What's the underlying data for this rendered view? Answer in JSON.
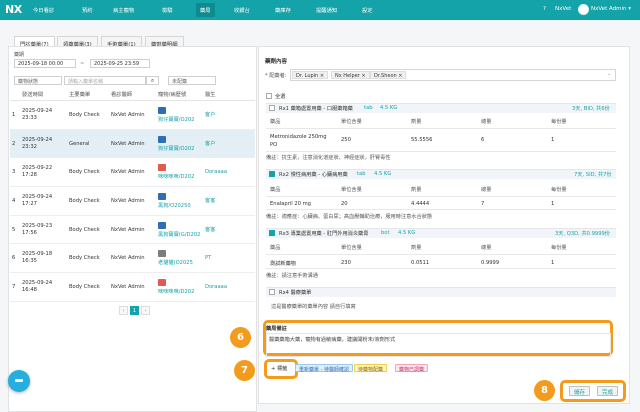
{
  "topbar": {
    "logo": "NX",
    "nav": [
      "今日看診",
      "預約",
      "病主寵物",
      "檢驗",
      "藥局",
      "收銀台",
      "藥庫存",
      "提醒通知",
      "設定"
    ],
    "help": "?",
    "brand": "NxVet",
    "user": "NxVet Admin ▾"
  },
  "tabs": [
    "門診藥單(7)",
    "領藥藥單(3)",
    "手術藥單(1)",
    "藥劑藥明細"
  ],
  "filters": {
    "date_label": "藥期",
    "date_from": "2025-09-18 00:00",
    "date_sep": "~",
    "date_to": "2025-09-25 23:59",
    "status_placeholder": "藥物狀態",
    "search_placeholder": "請輸入藥單名稱",
    "type_placeholder": "未配藥"
  },
  "orders_table": {
    "headers": [
      "",
      "發送時間",
      "主要藥單",
      "看診醫師",
      "寵物/病歷號",
      "醫生"
    ],
    "rows": [
      {
        "n": "1",
        "time": "2025-09-24 23:33",
        "type": "Body Check",
        "doctor": "NxVet Admin",
        "pet": "狗仔寶寶/O202",
        "vet": "客户",
        "icon": "blue"
      },
      {
        "n": "2",
        "time": "2025-09-24 23:32",
        "type": "General",
        "doctor": "NxVet Admin",
        "pet": "狗仔寶寶/O202",
        "vet": "客户",
        "icon": "blue"
      },
      {
        "n": "3",
        "time": "2025-09-22 17:28",
        "type": "Body Check",
        "doctor": "NxVet Admin",
        "pet": "咪咪咪咪/D202",
        "vet": "Doraaaa",
        "icon": "red"
      },
      {
        "n": "4",
        "time": "2025-09-24 17:27",
        "type": "Body Check",
        "doctor": "NxVet Admin",
        "pet": "黑狗/O20250",
        "vet": "客客",
        "icon": "blue"
      },
      {
        "n": "5",
        "time": "2025-09-23 17:56",
        "type": "Body Check",
        "doctor": "NxVet Admin",
        "pet": "黑狗寶寶(G/D202",
        "vet": "客客",
        "icon": "blue"
      },
      {
        "n": "6",
        "time": "2025-09-18 16:35",
        "type": "Body Check",
        "doctor": "NxVet Admin",
        "pet": "老貓貓(O2025",
        "vet": "PT",
        "icon": "gray"
      },
      {
        "n": "7",
        "time": "2025-09-24 16:48",
        "type": "Body Check",
        "doctor": "NxVet Admin",
        "pet": "咪咪咪咪/D202",
        "vet": "Doraaaa",
        "icon": "red"
      }
    ]
  },
  "pager": {
    "prev": "‹",
    "page": "1",
    "next": "›"
  },
  "right": {
    "section_title": "藥劑內容",
    "dispenser_label": "* 配藥者:",
    "dispensers": [
      "Dr. Lupin ×",
      "Nx Helper ×",
      "Dr.Sheon ×"
    ],
    "select_all": "全選",
    "rx": [
      {
        "title": "Rx1 藥箱處置用藥 - 口服藥箱藥",
        "tag": "tab",
        "amount": "4.5 KG",
        "freq": "3天, BID, 共6份",
        "checked": false,
        "headers": [
          "藥品",
          "單位含量",
          "劑量",
          "總量",
          "每份量"
        ],
        "row": [
          "Metronidazole 250mg PO",
          "250",
          "55.5556",
          "6",
          "1"
        ],
        "note": "備註：抗生素，注意消化道症狀、神經症狀，肝腎毒性"
      },
      {
        "title": "Rx2 慢性病用藥 - 心臟病用藥",
        "tag": "tab",
        "amount": "4.5 KG",
        "freq": "7天, SID, 共7份",
        "checked": true,
        "headers": [
          "藥品",
          "單位含量",
          "劑量",
          "總量",
          "每份量"
        ],
        "row": [
          "Enalapril 20 mg",
          "20",
          "4.4444",
          "7",
          "1"
        ],
        "note": "備註：適應症：心臟病、蛋白尿；高血壓輔助治療，服用時注意水合狀態"
      },
      {
        "title": "Rx3 專業處置用藥 - 肛門外用消炎藥膏",
        "tag": "bot",
        "amount": "4.5 KG",
        "freq": "3天, Q3D, 共0.9999份",
        "checked": true,
        "headers": [
          "藥品",
          "單位含量",
          "劑量",
          "總量",
          "每份量"
        ],
        "row": [
          "測試新藥物",
          "230",
          "0.0511",
          "0.9999",
          "1"
        ],
        "note": "備註：請注意手術溝通"
      },
      {
        "title": "Rx4 醫療藥單",
        "checked": false,
        "note": "這是醫療藥單的藥單內容 請自行填寫"
      }
    ],
    "memo_label": "藥局備註",
    "memo_text": "醫藥藥箱大藥，寵物有過敏病藥，建議開粉末/液劑形式",
    "add_tag": "+ 標籤",
    "tags": [
      "重新藥單 - 待醫師確認",
      "待藥物配藥",
      "藥物已調藥"
    ],
    "save": "儲存",
    "done": "完成"
  },
  "badges": [
    "6",
    "7",
    "8"
  ],
  "colors": {
    "accent": "#14a3a8",
    "highlight": "#f29b1c",
    "fab": "#26aee0"
  }
}
